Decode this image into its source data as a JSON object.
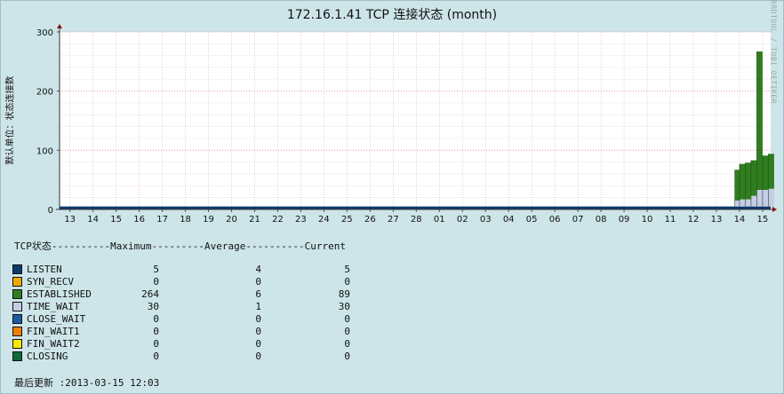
{
  "title": "172.16.1.41 TCP 连接状态 (month)",
  "watermark": "RRDTOOL / TOBI OETIKER",
  "legend_header": "TCP状态----------Maximum---------Average----------Current",
  "legend": [
    {
      "name": "LISTEN",
      "max": "5",
      "avg": "4",
      "cur": "5",
      "color": "#0b3a6e"
    },
    {
      "name": "SYN_RECV",
      "max": "0",
      "avg": "0",
      "cur": "0",
      "color": "#f0a800"
    },
    {
      "name": "ESTABLISHED",
      "max": "264",
      "avg": "6",
      "cur": "89",
      "color": "#2f7d1f"
    },
    {
      "name": "TIME_WAIT",
      "max": "30",
      "avg": "1",
      "cur": "30",
      "color": "#c6cce8"
    },
    {
      "name": "CLOSE_WAIT",
      "max": "0",
      "avg": "0",
      "cur": "0",
      "color": "#1e5aa0"
    },
    {
      "name": "FIN_WAIT1",
      "max": "0",
      "avg": "0",
      "cur": "0",
      "color": "#f08000"
    },
    {
      "name": "FIN_WAIT2",
      "max": "0",
      "avg": "0",
      "cur": "0",
      "color": "#f8e800"
    },
    {
      "name": "CLOSING",
      "max": "0",
      "avg": "0",
      "cur": "0",
      "color": "#0f6a3a"
    }
  ],
  "last_update": "最后更新 :2013-03-15 12:03",
  "chart_data": {
    "type": "area",
    "title": "172.16.1.41 TCP 连接状态 (month)",
    "ylabel": "默认单位：状态连接数",
    "xlabel": "",
    "ylim": [
      0,
      300
    ],
    "yticks": [
      0,
      100,
      200,
      300
    ],
    "xlim": [
      12.5,
      15.5
    ],
    "x_tick_labels": [
      "13",
      "14",
      "15",
      "16",
      "17",
      "18",
      "19",
      "20",
      "21",
      "22",
      "23",
      "24",
      "25",
      "26",
      "27",
      "28",
      "01",
      "02",
      "03",
      "04",
      "05",
      "06",
      "07",
      "08",
      "09",
      "10",
      "11",
      "12",
      "13",
      "14",
      "15"
    ],
    "grid": true,
    "stacked": true,
    "series": [
      {
        "name": "LISTEN",
        "color": "#0b3a6e",
        "x": [
          13.0,
          15.5
        ],
        "values": [
          5,
          5
        ]
      },
      {
        "name": "TIME_WAIT",
        "color": "#c6cce8",
        "x": [
          13.8,
          14.0,
          14.25,
          14.5,
          14.75,
          15.0,
          15.25
        ],
        "values": [
          10,
          12,
          12,
          18,
          28,
          28,
          30
        ]
      },
      {
        "name": "ESTABLISHED",
        "color": "#2f7d1f",
        "x": [
          13.8,
          14.0,
          14.25,
          14.5,
          14.75,
          15.0,
          15.25
        ],
        "values": [
          52,
          60,
          62,
          60,
          234,
          58,
          59
        ]
      }
    ]
  }
}
